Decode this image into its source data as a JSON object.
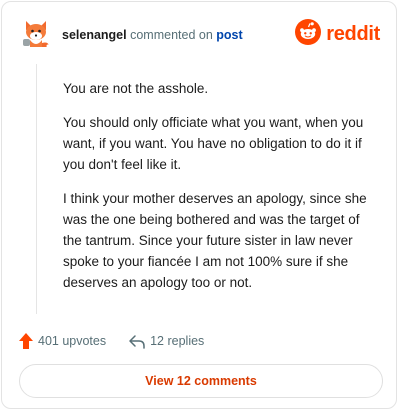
{
  "header": {
    "username": "selenangel",
    "action_text": "commented on",
    "post_link": "post",
    "avatar_icon": "fox-avatar-icon",
    "brand_icon": "reddit-logo-icon",
    "brand_word": "reddit"
  },
  "comment": {
    "paragraphs": [
      "You are not the asshole.",
      "You should only officiate what you want, when you want, if you want. You have no obligation to do it if you don't feel like it.",
      "I think your mother deserves an apology, since she was the one being bothered and was the target of the tantrum. Since your future sister in law never spoke to your fiancée I am not 100% sure if she deserves an apology too or not."
    ]
  },
  "stats": {
    "upvotes_label": "401 upvotes",
    "replies_label": "12 replies",
    "upvote_icon": "upvote-arrow-icon",
    "reply_icon": "reply-arrow-icon"
  },
  "footer": {
    "view_button_label": "View 12 comments"
  },
  "colors": {
    "brand": "#ff4500",
    "link": "#0045ac",
    "button_text": "#d93a00",
    "muted": "#576f76"
  }
}
